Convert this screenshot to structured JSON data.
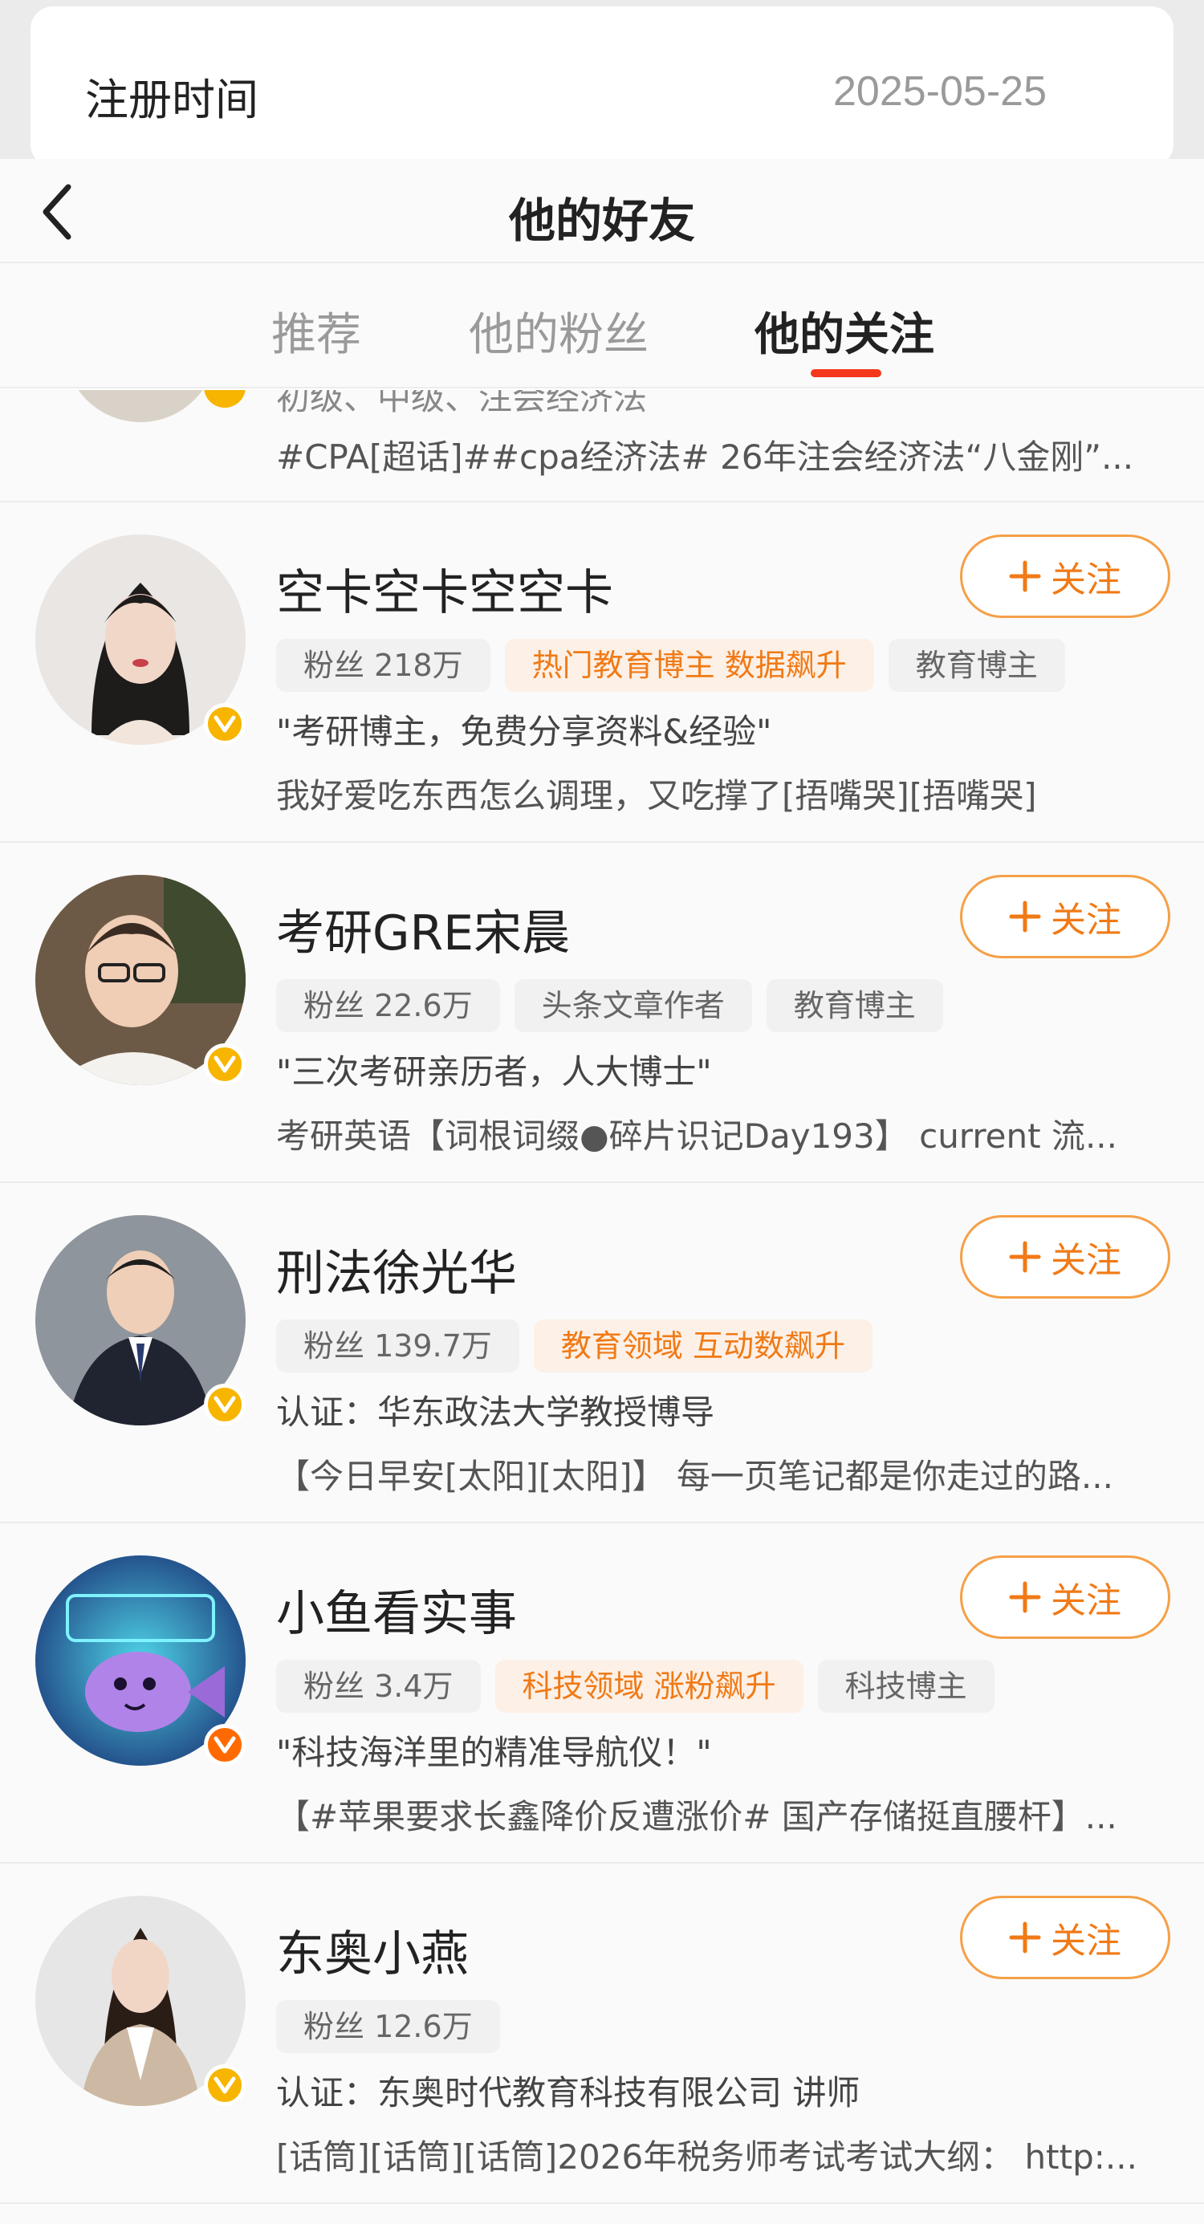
{
  "underlay": {
    "label": "注册时间",
    "value": "2025-05-25"
  },
  "nav": {
    "title": "他的好友"
  },
  "tabs": [
    {
      "label": "推荐",
      "active": false
    },
    {
      "label": "他的粉丝",
      "active": false
    },
    {
      "label": "他的关注",
      "active": true
    }
  ],
  "partial_row": {
    "bio": "初级、中级、注会经济法",
    "post": "#CPA[超话]##cpa经济法# 26年注会经济法“八金刚”..."
  },
  "follow_label": "关注",
  "users": [
    {
      "name": "空卡空卡空空卡",
      "fans": "粉丝 218万",
      "tags": [
        {
          "text": "热门教育博主 数据飙升",
          "hot": true
        },
        {
          "text": "教育博主",
          "hot": false
        }
      ],
      "bio": "\"考研博主，免费分享资料&经验\"",
      "post": "我好爱吃东西怎么调理，又吃撑了[捂嘴哭][捂嘴哭]",
      "badge": "yellow"
    },
    {
      "name": "考研GRE宋晨",
      "fans": "粉丝 22.6万",
      "tags": [
        {
          "text": "头条文章作者",
          "hot": false
        },
        {
          "text": "教育博主",
          "hot": false
        }
      ],
      "bio": "\"三次考研亲历者，人大博士\"",
      "post": "考研英语【词根词缀●碎片识记Day193】 current 流...",
      "badge": "yellow"
    },
    {
      "name": "刑法徐光华",
      "fans": "粉丝 139.7万",
      "tags": [
        {
          "text": "教育领域 互动数飙升",
          "hot": true
        }
      ],
      "bio": "认证：华东政法大学教授博导",
      "post": "【今日早安[太阳][太阳]】 每一页笔记都是你走过的路...",
      "badge": "yellow"
    },
    {
      "name": "小鱼看实事",
      "fans": "粉丝 3.4万",
      "tags": [
        {
          "text": "科技领域 涨粉飙升",
          "hot": true
        },
        {
          "text": "科技博主",
          "hot": false
        }
      ],
      "bio": "\"科技海洋里的精准导航仪！\"",
      "post": "【#苹果要求长鑫降价反遭涨价# 国产存储挺直腰杆】...",
      "badge": "orange"
    },
    {
      "name": "东奥小燕",
      "fans": "粉丝 12.6万",
      "tags": [],
      "bio": "认证：东奥时代教育科技有限公司 讲师",
      "post": "[话筒][话筒][话筒]2026年税务师考试考试大纲： http:...",
      "badge": "yellow"
    }
  ]
}
